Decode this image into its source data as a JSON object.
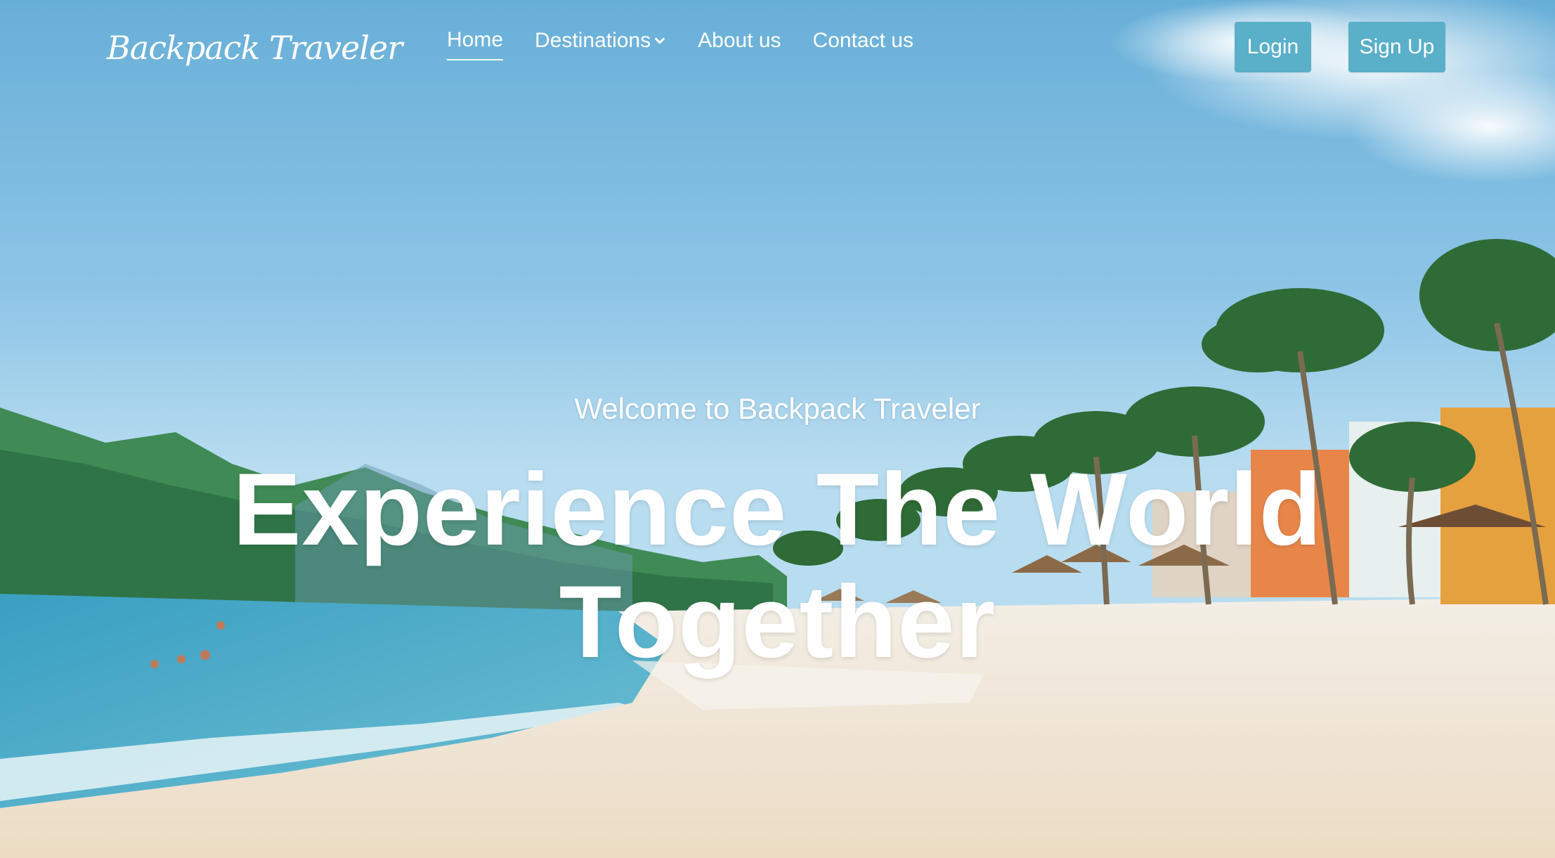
{
  "brand": {
    "logo_text": "Backpack Traveler"
  },
  "nav": {
    "items": [
      {
        "label": "Home",
        "active": true
      },
      {
        "label": "Destinations",
        "has_dropdown": true
      },
      {
        "label": "About us"
      },
      {
        "label": "Contact us"
      }
    ]
  },
  "auth": {
    "login_label": "Login",
    "signup_label": "Sign Up"
  },
  "hero": {
    "subtitle": "Welcome to Backpack Traveler",
    "title": "Experience The World Together"
  },
  "colors": {
    "button_bg": "#5aafc9",
    "text": "#ffffff"
  },
  "icons": {
    "dropdown": "chevron-down-icon"
  }
}
